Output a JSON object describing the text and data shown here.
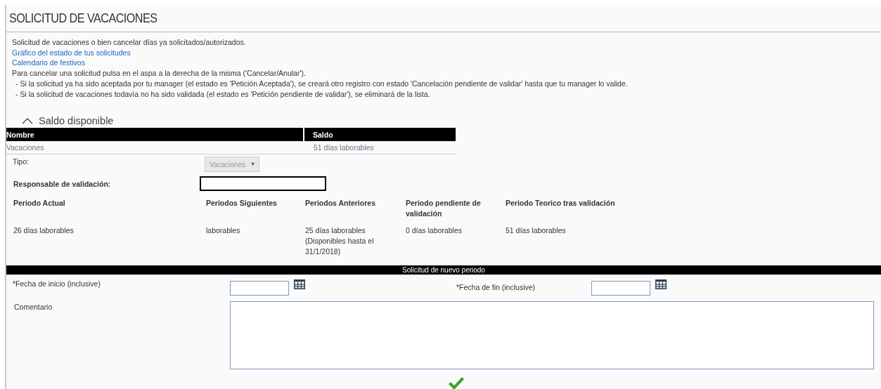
{
  "title": "SOLICITUD DE VACACIONES",
  "intro": {
    "description": "Solicitud de vacaciones o bien cancelar días ya solicitados/autorizados.",
    "links": [
      "Gráfico del estado de tus solicitudes",
      "Calendario de festivos"
    ],
    "instructions": "Para cancelar una solicitud pulsa en el aspa a la derecha de la misma ('Cancelar/Anular').",
    "bullets": [
      "- Si la solicitud ya ha sido aceptada por tu manager (el estado es 'Petición Aceptada'), se creará otro registro con estado 'Cancelación pendiente de validar' hasta que tu manager lo valide.",
      "- Si la solicitud de vacaciones todavía no ha sido validada (el estado es 'Petición pendiente de validar'), se eliminará de la lista."
    ]
  },
  "balance": {
    "heading": "Saldo disponible",
    "expanded": true,
    "columns": [
      "Nombre",
      "Saldo"
    ],
    "rows": [
      [
        "Vacaciones",
        "51 días laborables"
      ]
    ]
  },
  "type_field": {
    "label": "Tipo:",
    "value": "Vacaciones",
    "disabled": true
  },
  "validator_field": {
    "label": "Responsable de validación:"
  },
  "periods": [
    {
      "header": "Periodo Actual",
      "value": "26 días laborables"
    },
    {
      "header": "Periodos Siguientes",
      "value": "laborables"
    },
    {
      "header": "Periodos Anteriores",
      "value": "25 días laborables (Disponibles hasta el 31/1/2018)"
    },
    {
      "header": "Periodo pendiente de validación",
      "value": "0 días laborables"
    },
    {
      "header": "Periodo Teorico tras validación",
      "value": "51 días laborables"
    }
  ],
  "new_period": {
    "heading": "Solicitud de nuevo periodo",
    "start_label": "*Fecha de inicio (inclusive)",
    "end_label": "*Fecha de fin (inclusive)",
    "comment_label": "Comentario"
  }
}
